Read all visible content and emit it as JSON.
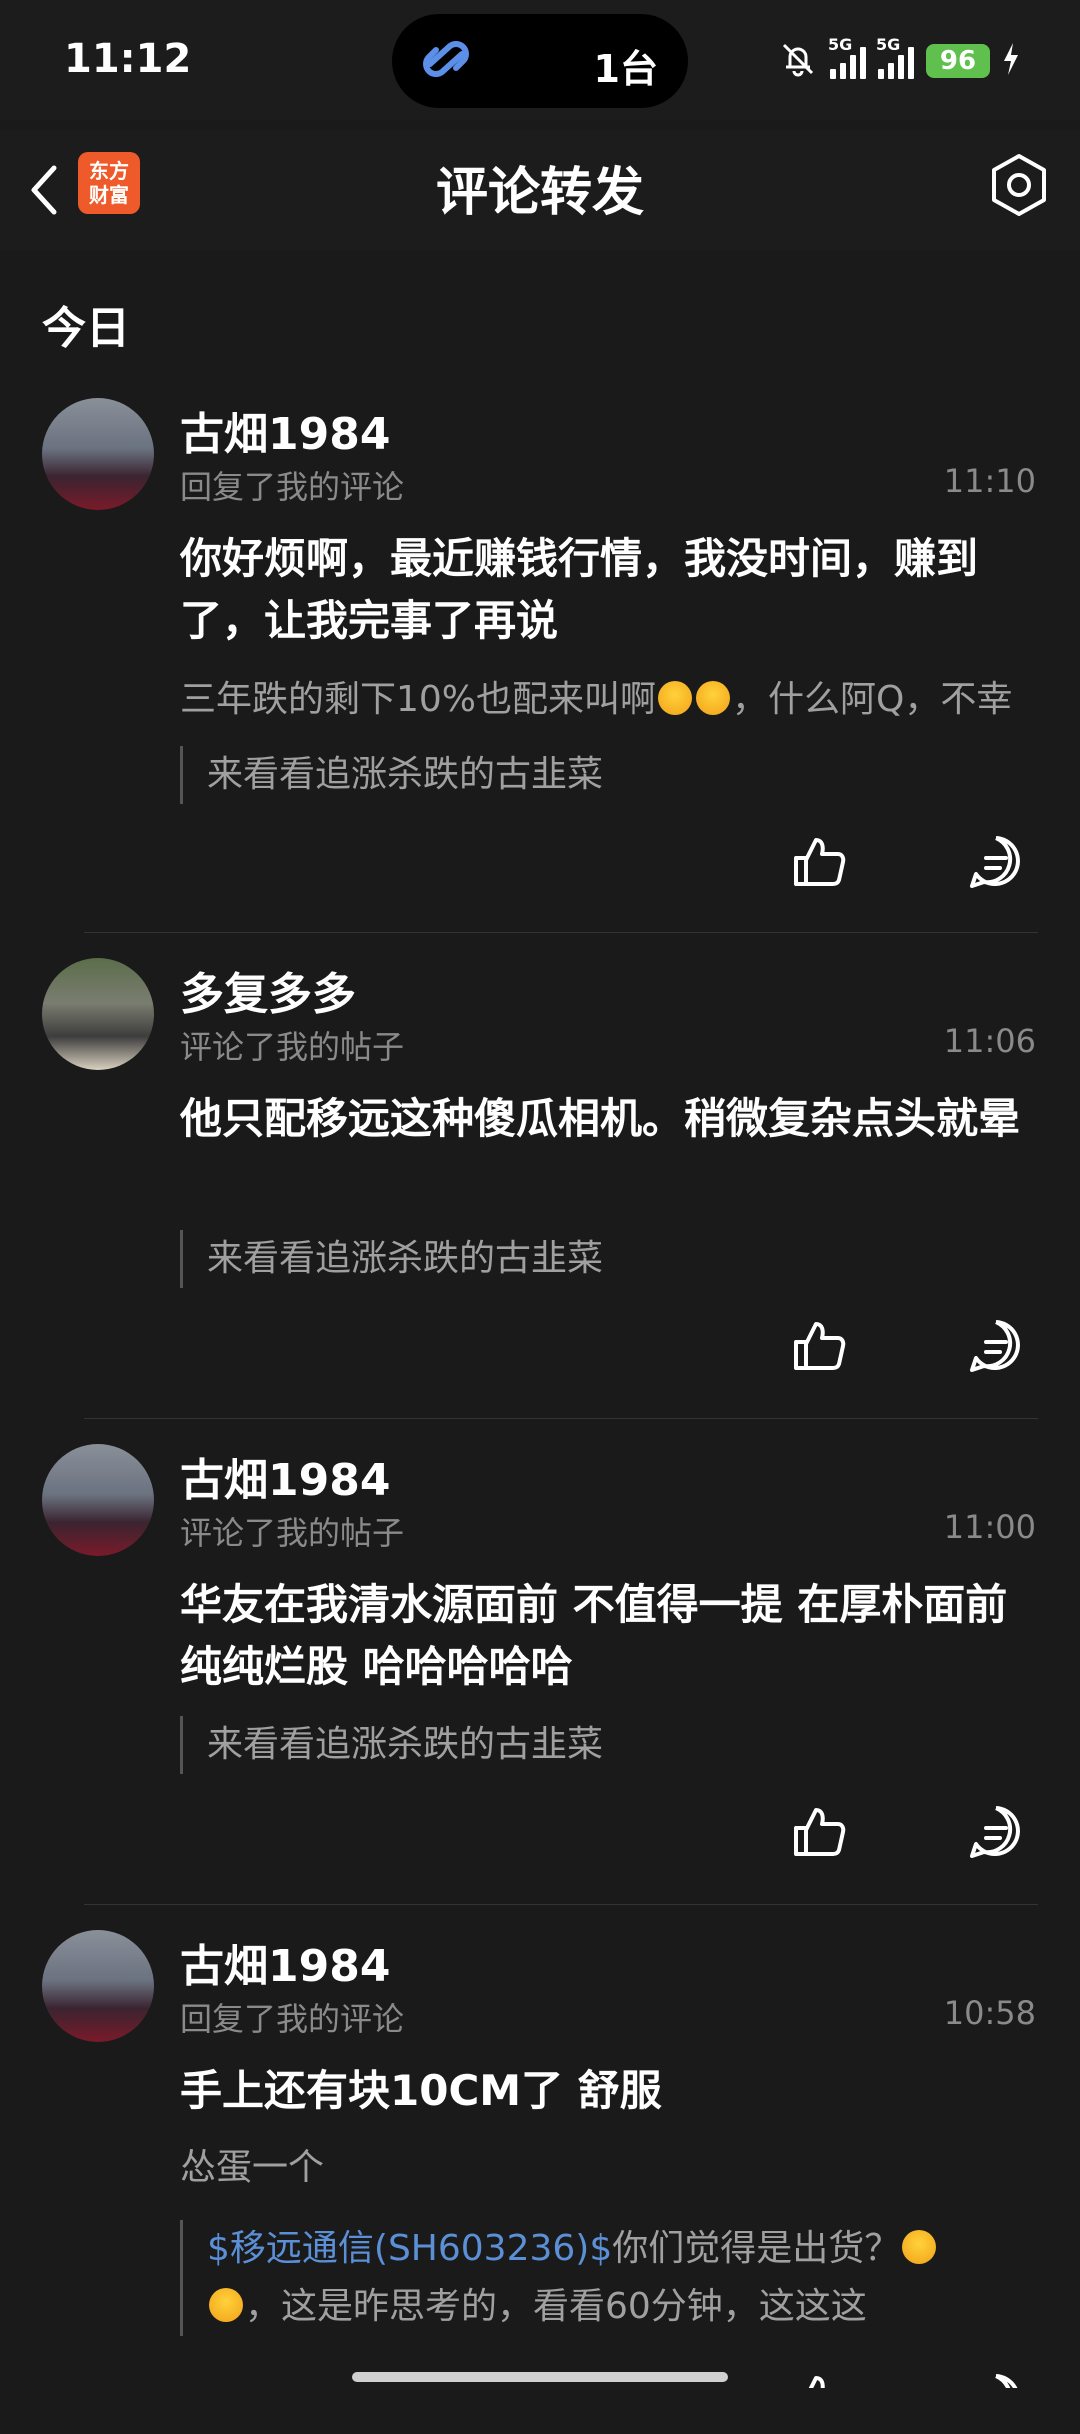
{
  "status": {
    "time": "11:12",
    "island_text": "1台",
    "sig1": "5G",
    "sig2": "5G",
    "battery": "96"
  },
  "nav": {
    "title": "评论转发",
    "logo_top": "东方",
    "logo_bottom": "财富"
  },
  "section": {
    "label": "今日"
  },
  "items": [
    {
      "user": "古畑1984",
      "action": "回复了我的评论",
      "time": "11:10",
      "text": "你好烦啊，最近赚钱行情，我没时间，赚到了，让我完事了再说",
      "quote_a": "三年跌的剩下10%也配来叫啊",
      "quote_b": "，什么阿Q，不幸",
      "post": "来看看追涨杀跌的古韭菜"
    },
    {
      "user": "多复多多",
      "action": "评论了我的帖子",
      "time": "11:06",
      "text": "他只配移远这种傻瓜相机。稍微复杂点头就晕",
      "post": "来看看追涨杀跌的古韭菜"
    },
    {
      "user": "古畑1984",
      "action": "评论了我的帖子",
      "time": "11:00",
      "text": "华友在我清水源面前 不值得一提 在厚朴面前 纯纯烂股 哈哈哈哈哈",
      "post": "来看看追涨杀跌的古韭菜"
    },
    {
      "user": "古畑1984",
      "action": "回复了我的评论",
      "time": "10:58",
      "text": "手上还有块10CM了 舒服",
      "quote": "怂蛋一个",
      "post_link": "$移远通信(SH603236)$",
      "post_a": "你们觉得是出货？",
      "post_b": "，这是昨思考的，看看60分钟，这这这"
    }
  ]
}
